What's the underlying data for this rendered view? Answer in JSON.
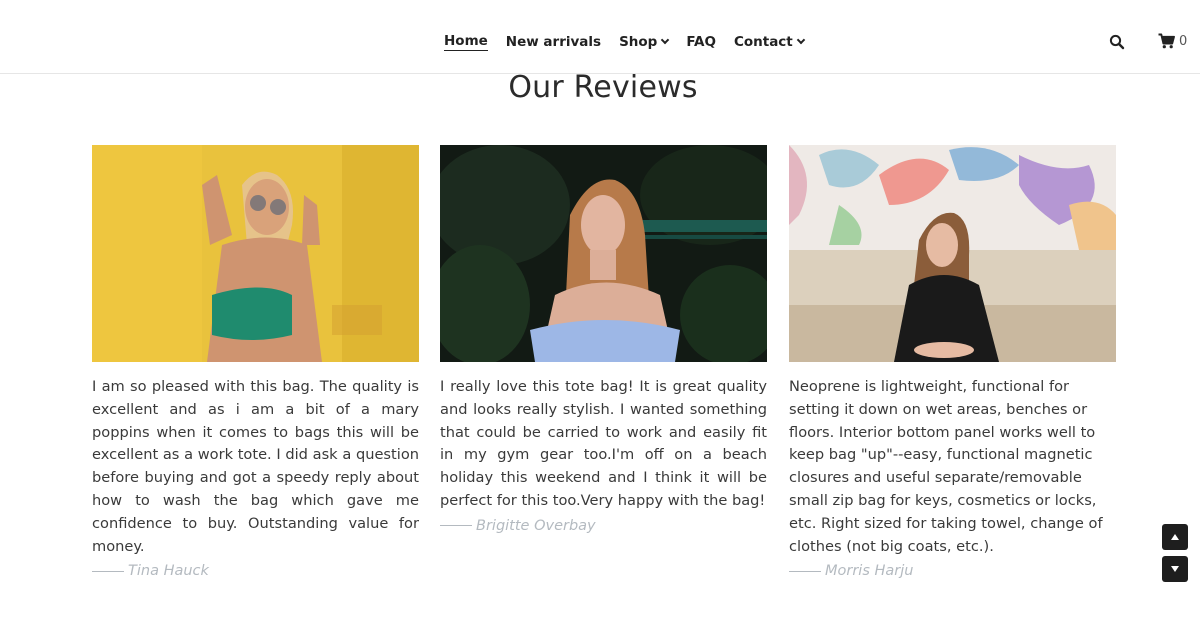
{
  "nav": {
    "items": [
      {
        "label": "Home",
        "active": true,
        "dropdown": false
      },
      {
        "label": "New arrivals",
        "active": false,
        "dropdown": false
      },
      {
        "label": "Shop",
        "active": false,
        "dropdown": true
      },
      {
        "label": "FAQ",
        "active": false,
        "dropdown": false
      },
      {
        "label": "Contact",
        "active": false,
        "dropdown": true
      }
    ],
    "search_icon": "search-icon",
    "cart_icon": "cart-icon",
    "cart_count": "0"
  },
  "section_title": "Our Reviews",
  "reviews": [
    {
      "photo": "woman with sunglasses against yellow wall",
      "text": "I am so pleased with this bag. The quality is excellent and as i am a bit of a mary poppins when it comes to bags this will be excellent as a work tote. I did ask a question before buying and got a speedy reply about how to wash the bag which gave me confidence to buy. Outstanding value for money.",
      "author": "Tina Hauck"
    },
    {
      "photo": "woman in blue off-shoulder dress among dark foliage",
      "text": "I really love this tote bag! It is great quality and looks really stylish. I wanted something that could be carried to work and easily fit in my gym gear too.I'm off on a beach holiday this weekend and I think it will be perfect for this too.Very happy with the bag!",
      "author": "Brigitte Overbay"
    },
    {
      "photo": "smiling woman sitting in front of colorful mural",
      "text": "Neoprene is lightweight, functional for setting it down on wet areas, benches or floors. Interior bottom panel works well to keep bag \"up\"--easy, functional magnetic closures and useful separate/removable small zip bag for keys, cosmetics or locks, etc. Right sized for taking towel, change of clothes (not big coats, etc.).",
      "author": "Morris Harju"
    }
  ],
  "scroll": {
    "up_icon": "arrow-up-icon",
    "down_icon": "arrow-down-icon"
  },
  "colors": {
    "text": "#3a3a3a",
    "author": "#b4bac0",
    "scroll_button": "#1e1e1e"
  }
}
